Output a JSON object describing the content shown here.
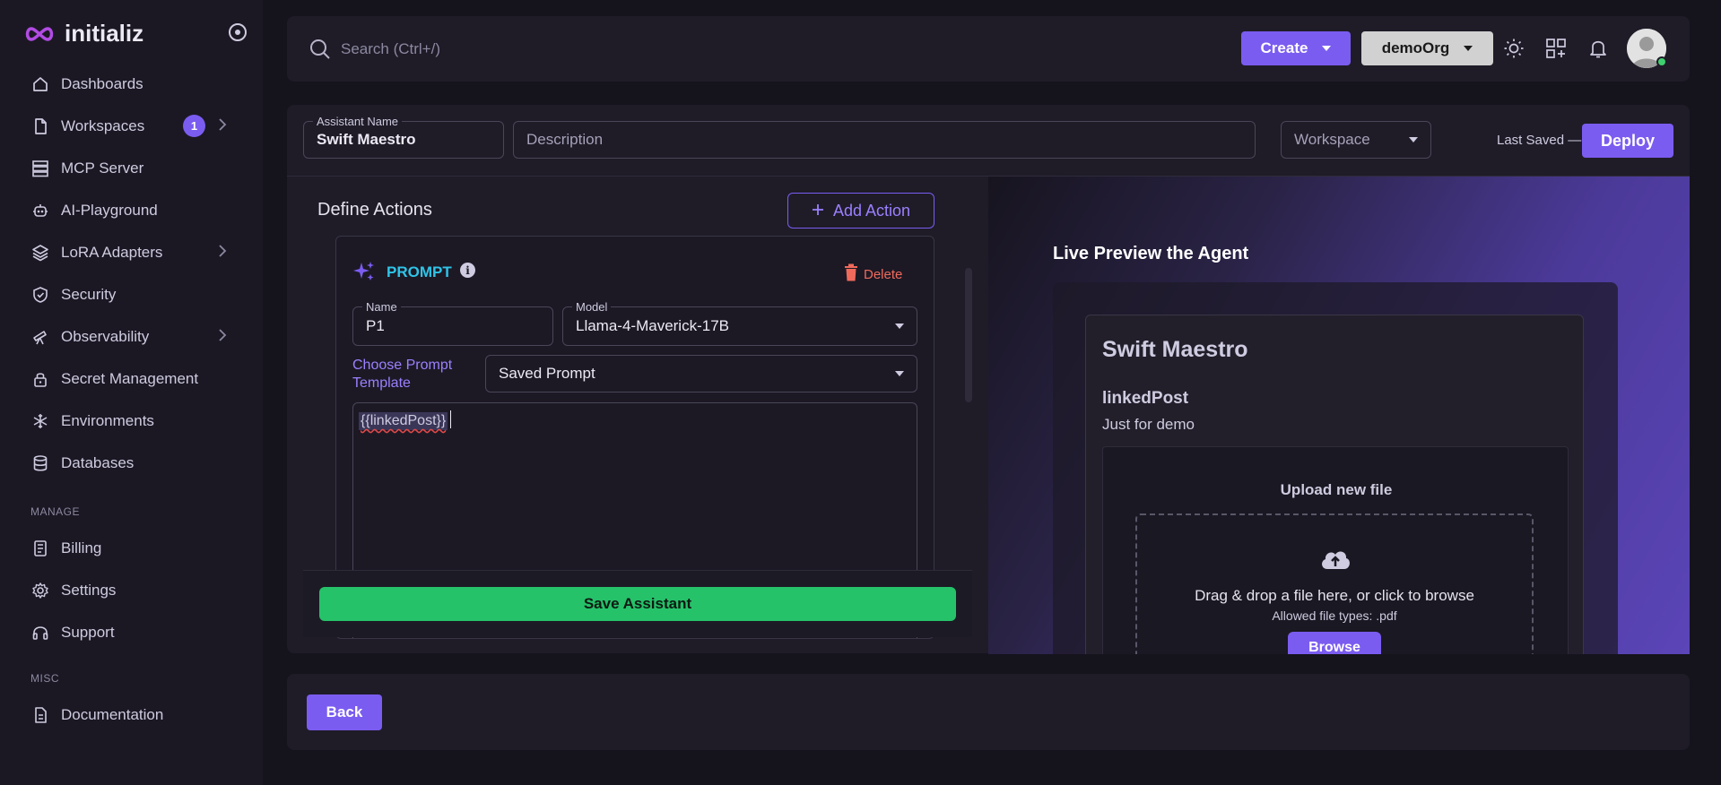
{
  "brand": {
    "name": "initializ"
  },
  "sidebar": {
    "items": [
      {
        "label": "Dashboards",
        "icon": "home-icon"
      },
      {
        "label": "Workspaces",
        "icon": "file-icon",
        "badge": "1"
      },
      {
        "label": "MCP Server",
        "icon": "server-icon"
      },
      {
        "label": "AI-Playground",
        "icon": "robot-icon"
      },
      {
        "label": "LoRA Adapters",
        "icon": "layers-icon"
      },
      {
        "label": "Security",
        "icon": "shield-icon"
      },
      {
        "label": "Observability",
        "icon": "telescope-icon"
      },
      {
        "label": "Secret Management",
        "icon": "lock-icon"
      },
      {
        "label": "Environments",
        "icon": "snowflake-icon"
      },
      {
        "label": "Databases",
        "icon": "database-icon"
      }
    ],
    "manage_heading": "MANAGE",
    "manage_items": [
      {
        "label": "Billing",
        "icon": "receipt-icon"
      },
      {
        "label": "Settings",
        "icon": "gear-icon"
      },
      {
        "label": "Support",
        "icon": "headset-icon"
      }
    ],
    "misc_heading": "MISC",
    "misc_items": [
      {
        "label": "Documentation",
        "icon": "document-icon"
      }
    ]
  },
  "topbar": {
    "search_placeholder": "Search (Ctrl+/)",
    "create_label": "Create",
    "org_label": "demoOrg"
  },
  "editor": {
    "assistant_name_label": "Assistant Name",
    "assistant_name_value": "Swift Maestro",
    "description_placeholder": "Description",
    "workspace_placeholder": "Workspace",
    "last_saved": "Last Saved —",
    "deploy_label": "Deploy"
  },
  "actions": {
    "title": "Define Actions",
    "add_label": "Add Action",
    "card": {
      "type_label": "PROMPT",
      "info": "i",
      "delete_label": "Delete",
      "name_label": "Name",
      "name_value": "P1",
      "model_label": "Model",
      "model_value": "Llama-4-Maverick-17B",
      "choose_template_label": "Choose Prompt Template",
      "template_value": "Saved Prompt",
      "prompt_text": "{{linkedPost}}"
    },
    "save_label": "Save Assistant"
  },
  "preview": {
    "title": "Live Preview the Agent",
    "assistant_name": "Swift Maestro",
    "action_name": "linkedPost",
    "action_desc": "Just for demo",
    "upload_title": "Upload new file",
    "drop_text": "Drag & drop a file here, or click to browse",
    "allowed_text": "Allowed file types: .pdf",
    "browse_label": "Browse"
  },
  "footer": {
    "back_label": "Back"
  },
  "colors": {
    "accent": "#7b5cf0",
    "success": "#26c26a",
    "danger": "#f06a5c",
    "prompt_title": "#2fc4e8"
  }
}
